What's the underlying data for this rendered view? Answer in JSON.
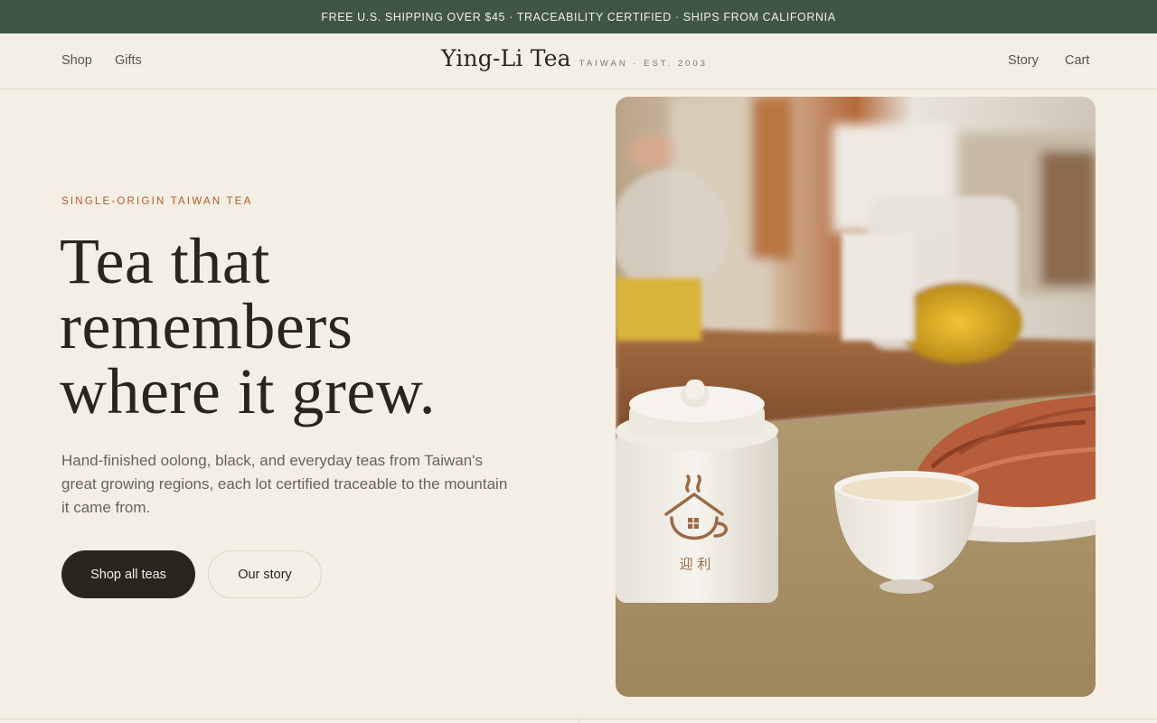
{
  "announcement": "FREE U.S. SHIPPING OVER $45 · TRACEABILITY CERTIFIED · SHIPS FROM CALIFORNIA",
  "header": {
    "nav_left": [
      "Shop",
      "Gifts"
    ],
    "logo": {
      "name": "Ying-Li Tea",
      "tagline": "TAIWAN · EST. 2003"
    },
    "nav_right": [
      "Story",
      "Cart"
    ]
  },
  "hero": {
    "eyebrow": "SINGLE-ORIGIN TAIWAN TEA",
    "headline": [
      "Tea that",
      "remembers",
      "where it grew."
    ],
    "lede": "Hand-finished oolong, black, and everyday teas from Taiwan's great growing regions, each lot certified traceable to the mountain it came from.",
    "primary_cta": "Shop all teas",
    "secondary_cta": "Our story",
    "image": {
      "subject": "tea-scene-photo",
      "caddy_mark": "迎 利"
    }
  },
  "colors": {
    "announcement_bg": "#3e5642",
    "page_bg": "#f4efe4",
    "text": "#2b2520",
    "accent": "#b05a2b",
    "muted": "#6a625a"
  }
}
